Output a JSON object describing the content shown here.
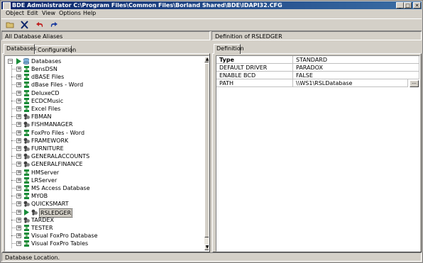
{
  "window": {
    "title": "BDE Administrator  C:\\Program Files\\Common Files\\Borland Shared\\BDE\\IDAPI32.CFG",
    "buttons": {
      "minimize": "_",
      "maximize": "□",
      "close": "✕"
    }
  },
  "menu": [
    "Object",
    "Edit",
    "View",
    "Options",
    "Help"
  ],
  "toolbar": {
    "icons": [
      "open-folder-icon",
      "delete-icon",
      "undo-icon",
      "redo-icon"
    ]
  },
  "left_panel": {
    "header": "All Database Aliases",
    "tabs": [
      "Databases",
      "Configuration"
    ],
    "active_tab": "Databases",
    "tree": {
      "root": "Databases",
      "items": [
        {
          "label": "BensDSN",
          "icon": "odbc"
        },
        {
          "label": "dBASE Files",
          "icon": "odbc"
        },
        {
          "label": "dBase Files - Word",
          "icon": "odbc"
        },
        {
          "label": "DeluxeCD",
          "icon": "odbc"
        },
        {
          "label": "ECDCMusic",
          "icon": "odbc"
        },
        {
          "label": "Excel Files",
          "icon": "odbc"
        },
        {
          "label": "FBMAN",
          "icon": "native"
        },
        {
          "label": "FISHMANAGER",
          "icon": "native"
        },
        {
          "label": "FoxPro Files - Word",
          "icon": "odbc"
        },
        {
          "label": "FRAMEWORK",
          "icon": "native"
        },
        {
          "label": "FURNITURE",
          "icon": "native"
        },
        {
          "label": "GENERALACCOUNTS",
          "icon": "native"
        },
        {
          "label": "GENERALFINANCE",
          "icon": "native"
        },
        {
          "label": "HMServer",
          "icon": "odbc"
        },
        {
          "label": "LRServer",
          "icon": "odbc"
        },
        {
          "label": "MS Access Database",
          "icon": "odbc"
        },
        {
          "label": "MYOB",
          "icon": "odbc"
        },
        {
          "label": "QUICKSMART",
          "icon": "native"
        },
        {
          "label": "RSLEDGER",
          "icon": "native",
          "selected": true,
          "open": true
        },
        {
          "label": "TARDEX",
          "icon": "native"
        },
        {
          "label": "TESTER",
          "icon": "odbc"
        },
        {
          "label": "Visual FoxPro Database",
          "icon": "odbc"
        },
        {
          "label": "Visual FoxPro Tables",
          "icon": "odbc"
        }
      ]
    }
  },
  "right_panel": {
    "header": "Definition of RSLEDGER",
    "tabs": [
      "Definition"
    ],
    "properties": [
      {
        "name": "Type",
        "value": "STANDARD",
        "bold": true
      },
      {
        "name": "DEFAULT DRIVER",
        "value": "PARADOX"
      },
      {
        "name": "ENABLE BCD",
        "value": "FALSE"
      },
      {
        "name": "PATH",
        "value": "\\\\WS1\\RSLDatabase",
        "editing": true
      }
    ],
    "ellipsis_button": "..."
  },
  "status_bar": "Database Location.",
  "colors": {
    "title_gradient_start": "#0a246a",
    "title_gradient_end": "#3a6ea5",
    "face": "#d4d0c8",
    "odbc_icon_green": "#1a8c3a",
    "native_icon_dark": "#404040"
  }
}
